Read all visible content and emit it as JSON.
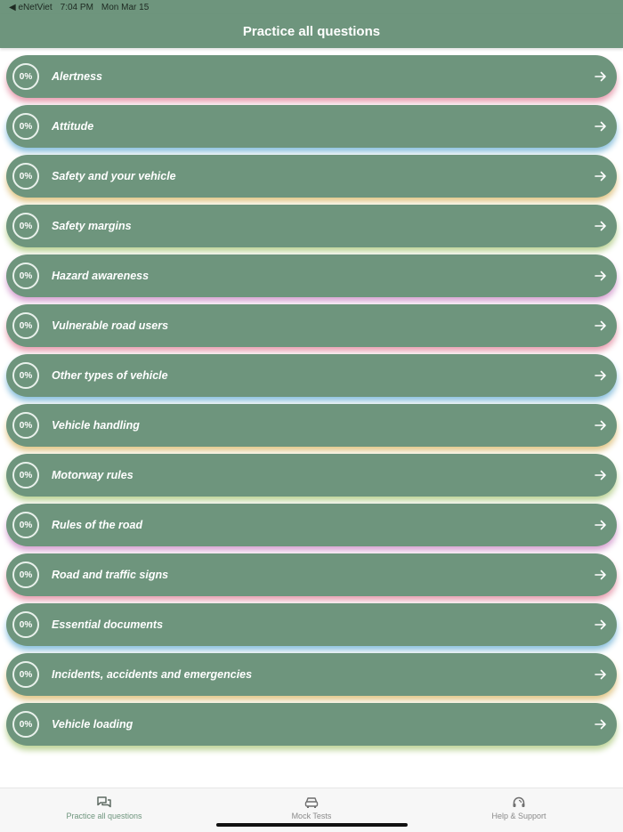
{
  "status_bar": {
    "back_app": "◀ eNetViet",
    "time": "7:04 PM",
    "date": "Mon Mar 15"
  },
  "header": {
    "title": "Practice all questions"
  },
  "topics": [
    {
      "progress": "0%",
      "label": "Alertness",
      "glow": "#e9a3b4"
    },
    {
      "progress": "0%",
      "label": "Attitude",
      "glow": "#8fc3df"
    },
    {
      "progress": "0%",
      "label": "Safety and your vehicle",
      "glow": "#e3c98c"
    },
    {
      "progress": "0%",
      "label": "Safety margins",
      "glow": "#bfd59a"
    },
    {
      "progress": "0%",
      "label": "Hazard awareness",
      "glow": "#d9a6d4"
    },
    {
      "progress": "0%",
      "label": "Vulnerable road users",
      "glow": "#e9a3b4"
    },
    {
      "progress": "0%",
      "label": "Other types of vehicle",
      "glow": "#8fc3df"
    },
    {
      "progress": "0%",
      "label": "Vehicle handling",
      "glow": "#e3c98c"
    },
    {
      "progress": "0%",
      "label": "Motorway rules",
      "glow": "#bfd59a"
    },
    {
      "progress": "0%",
      "label": "Rules of the road",
      "glow": "#d9a6d4"
    },
    {
      "progress": "0%",
      "label": "Road and traffic signs",
      "glow": "#e9a3b4"
    },
    {
      "progress": "0%",
      "label": "Essential documents",
      "glow": "#8fc3df"
    },
    {
      "progress": "0%",
      "label": "Incidents, accidents and emergencies",
      "glow": "#e3c98c"
    },
    {
      "progress": "0%",
      "label": "Vehicle loading",
      "glow": "#bfd59a"
    }
  ],
  "tabbar": {
    "tabs": [
      {
        "label": "Practice all questions",
        "icon": "chat-bubbles-icon",
        "active": true
      },
      {
        "label": "Mock Tests",
        "icon": "car-icon",
        "active": false
      },
      {
        "label": "Help & Support",
        "icon": "headset-icon",
        "active": false
      }
    ]
  },
  "colors": {
    "accent": "#6e957d",
    "text_on_accent": "#ffffff",
    "tab_inactive": "#8a8a8a"
  }
}
